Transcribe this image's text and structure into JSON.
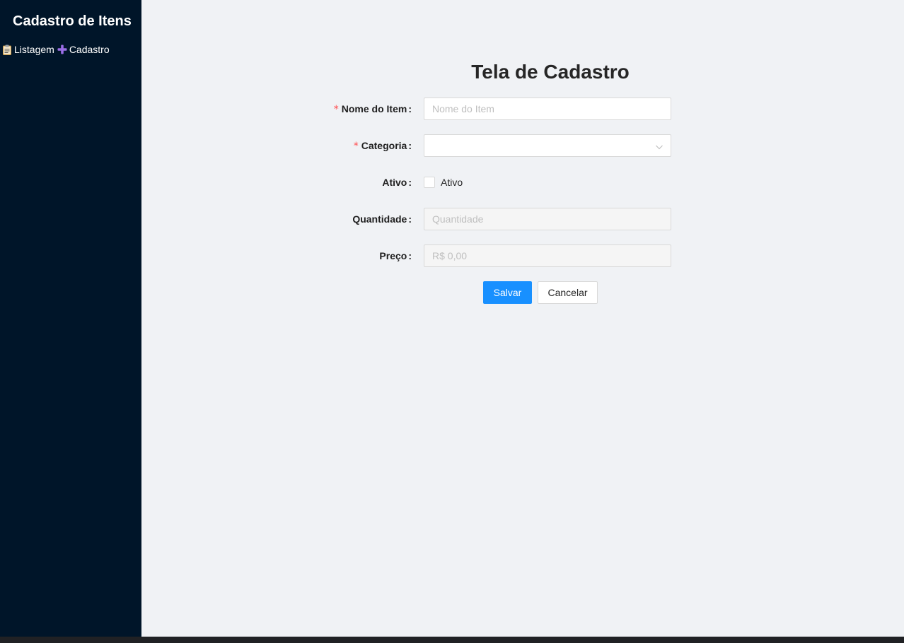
{
  "sidebar": {
    "title": "Cadastro de Itens",
    "nav": [
      {
        "icon": "clipboard-icon",
        "label": "Listagem"
      },
      {
        "icon": "plus-icon",
        "label": "Cadastro"
      }
    ]
  },
  "form": {
    "title": "Tela de Cadastro",
    "fields": {
      "nome": {
        "label": "Nome do Item",
        "required": true,
        "placeholder": "Nome do Item",
        "value": ""
      },
      "categoria": {
        "label": "Categoria",
        "required": true,
        "value": ""
      },
      "ativo": {
        "label": "Ativo",
        "checkbox_label": "Ativo",
        "checked": false
      },
      "quantidade": {
        "label": "Quantidade",
        "placeholder": "Quantidade",
        "disabled": true
      },
      "preco": {
        "label": "Preço",
        "placeholder": "R$ 0,00",
        "disabled": true
      }
    },
    "required_mark": "*",
    "colon": ":",
    "buttons": {
      "save": "Salvar",
      "cancel": "Cancelar"
    }
  },
  "colors": {
    "sidebar_bg": "#001529",
    "primary": "#1890ff",
    "required": "#ff4d4f",
    "page_bg": "#f0f2f5"
  }
}
